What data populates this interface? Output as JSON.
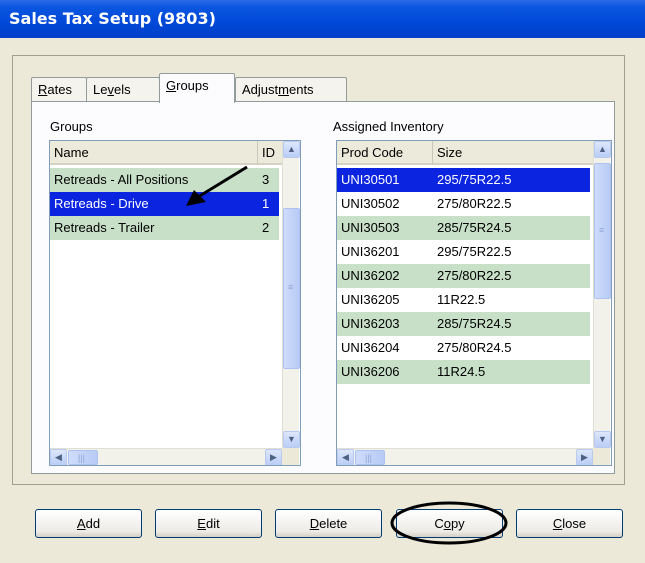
{
  "window": {
    "title": "Sales Tax Setup (9803)"
  },
  "tabs": [
    {
      "pre": "",
      "u": "R",
      "post": "ates"
    },
    {
      "pre": "Le",
      "u": "v",
      "post": "els"
    },
    {
      "pre": "",
      "u": "G",
      "post": "roups"
    },
    {
      "pre": "Adjust",
      "u": "m",
      "post": "ents"
    }
  ],
  "active_tab": "Groups",
  "groups": {
    "label": "Groups",
    "columns": [
      "Name",
      "ID"
    ],
    "rows": [
      {
        "name": "Retreads - All Positions",
        "id": "3",
        "style": "green"
      },
      {
        "name": "Retreads - Drive",
        "id": "1",
        "style": "selected"
      },
      {
        "name": "Retreads - Trailer",
        "id": "2",
        "style": "green"
      }
    ]
  },
  "inventory": {
    "label": "Assigned Inventory",
    "columns": [
      "Prod Code",
      "Size"
    ],
    "rows": [
      {
        "code": "UNI30501",
        "size": "295/75R22.5",
        "style": "selected"
      },
      {
        "code": "UNI30502",
        "size": "275/80R22.5",
        "style": "plain"
      },
      {
        "code": "UNI30503",
        "size": "285/75R24.5",
        "style": "green"
      },
      {
        "code": "UNI36201",
        "size": "295/75R22.5",
        "style": "plain"
      },
      {
        "code": "UNI36202",
        "size": "275/80R22.5",
        "style": "green"
      },
      {
        "code": "UNI36205",
        "size": "11R22.5",
        "style": "plain"
      },
      {
        "code": "UNI36203",
        "size": "285/75R24.5",
        "style": "green"
      },
      {
        "code": "UNI36204",
        "size": "275/80R24.5",
        "style": "plain"
      },
      {
        "code": "UNI36206",
        "size": "11R24.5",
        "style": "green"
      }
    ]
  },
  "buttons": [
    {
      "pre": "",
      "u": "A",
      "post": "dd"
    },
    {
      "pre": "",
      "u": "E",
      "post": "dit"
    },
    {
      "pre": "",
      "u": "D",
      "post": "elete"
    },
    {
      "pre": "C",
      "u": "o",
      "post": "py"
    },
    {
      "pre": "",
      "u": "C",
      "post": "lose"
    }
  ],
  "icons": {
    "scroll_up": "up-arrow-icon",
    "scroll_down": "down-arrow-icon",
    "scroll_left": "left-arrow-icon",
    "scroll_right": "right-arrow-icon"
  },
  "colors": {
    "selected_row": "#0a24e0",
    "alt_row": "#c8e0c8",
    "title_bar": "#0048d8"
  }
}
